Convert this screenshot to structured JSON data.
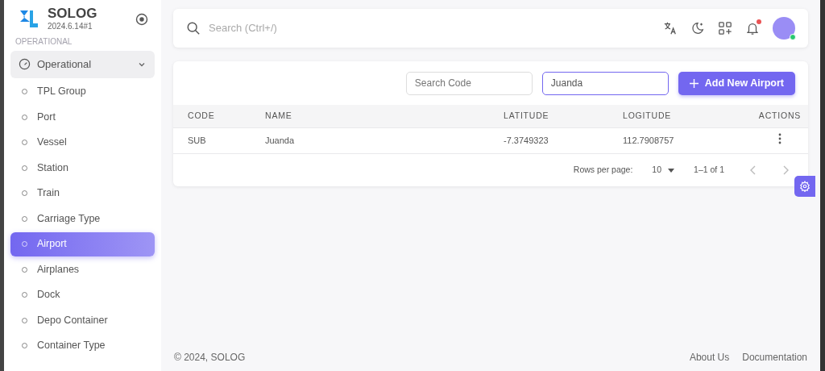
{
  "brand": {
    "name": "SOLOG",
    "version": "2024.6.14#1"
  },
  "sidebar": {
    "section_header": "OPERATIONAL",
    "group": {
      "label": "Operational",
      "expanded": true
    },
    "items": [
      {
        "label": "TPL Group",
        "selected": false
      },
      {
        "label": "Port",
        "selected": false
      },
      {
        "label": "Vessel",
        "selected": false
      },
      {
        "label": "Station",
        "selected": false
      },
      {
        "label": "Train",
        "selected": false
      },
      {
        "label": "Carriage Type",
        "selected": false
      },
      {
        "label": "Airport",
        "selected": true
      },
      {
        "label": "Airplanes",
        "selected": false
      },
      {
        "label": "Dock",
        "selected": false
      },
      {
        "label": "Depo Container",
        "selected": false
      },
      {
        "label": "Container Type",
        "selected": false
      }
    ]
  },
  "topbar": {
    "search": {
      "placeholder": "Search (Ctrl+/)"
    },
    "notification_unread": true,
    "user_online": true
  },
  "filters": {
    "code": {
      "placeholder": "Search Code"
    },
    "name": {
      "value": "Juanda"
    },
    "add_button": "Add New Airport"
  },
  "table": {
    "columns": [
      "CODE",
      "NAME",
      "LATITUDE",
      "LOGITUDE",
      "ACTIONS"
    ],
    "rows": [
      [
        "SUB",
        "Juanda",
        "-7.3749323",
        "112.7908757"
      ]
    ]
  },
  "pagination": {
    "rows_per_page_label": "Rows per page:",
    "rows_per_page": "10",
    "range": "1–1 of 1"
  },
  "footer": {
    "copyright": "© 2024, SOLOG",
    "links": [
      "About Us",
      "Documentation"
    ]
  }
}
